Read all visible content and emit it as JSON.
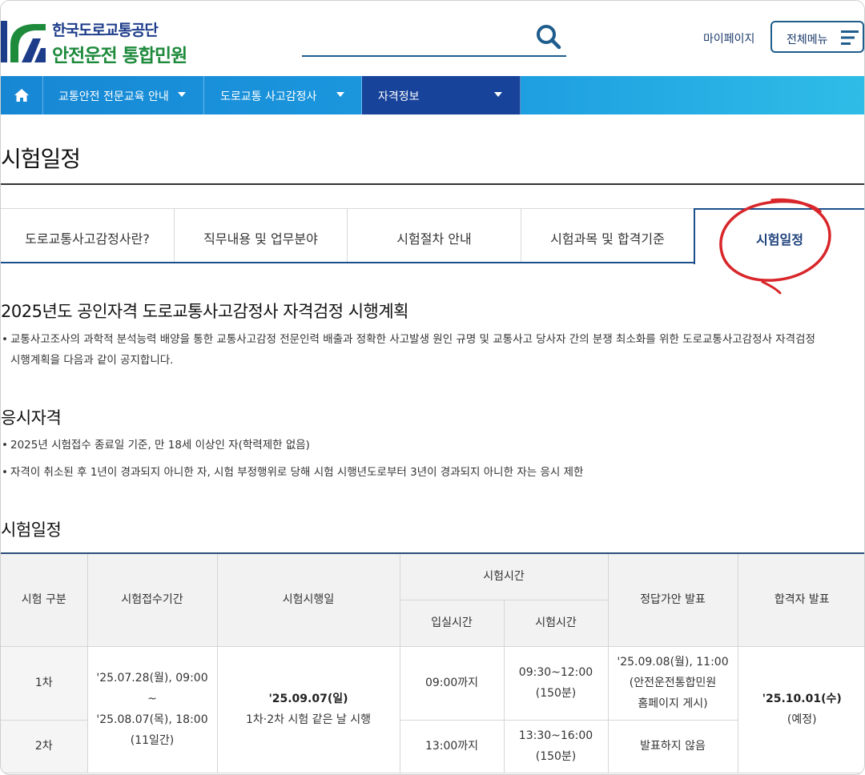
{
  "header": {
    "logo_line1": "한국도로교통공단",
    "logo_line2": "안전운전 통합민원",
    "search_icon": "search-icon",
    "mypage": "마이페이지",
    "allmenu": "전체메뉴",
    "menu_icon": "hamburger-menu-icon"
  },
  "nav": {
    "home_icon": "home-icon",
    "items": [
      {
        "label": "교통안전 전문교육 안내"
      },
      {
        "label": "도로교통 사고감정사"
      },
      {
        "label": "자격정보"
      }
    ],
    "colors": {
      "bar_start": "#1787d4",
      "bar_end": "#2fbde7",
      "active": "#17439b"
    }
  },
  "page_title": "시험일정",
  "tabs": [
    {
      "label": "도로교통사고감정사란?"
    },
    {
      "label": "직무내용 및 업무분야"
    },
    {
      "label": "시험절차 안내"
    },
    {
      "label": "시험과목 및 합격기준"
    },
    {
      "label": "시험일정",
      "active": true
    }
  ],
  "section1": {
    "title": "2025년도 공인자격 도로교통사고감정사 자격검정 시행계획",
    "line1": "교통사고조사의 과학적 분석능력 배양을 통한 교통사고감정 전문인력 배출과 정확한 사고발생 원인 규명 및 교통사고 당사자 간의 분쟁 최소화를 위한 도로교통사고감정사 자격검정",
    "line2": "시행계획을 다음과 같이 공지합니다."
  },
  "section2": {
    "title": "응시자격",
    "items": [
      "2025년 시험접수 종료일 기준, 만 18세 이상인 자(학력제한 없음)",
      "자격이 취소된 후 1년이 경과되지 아니한 자, 시험 부정행위로 당해 시험 시행년도로부터 3년이 경과되지 아니한 자는 응시 제한"
    ]
  },
  "section3": {
    "title": "시험일정",
    "table": {
      "headers": {
        "type": "시험 구분",
        "apply": "시험접수기간",
        "date": "시험시행일",
        "time": "시험시간",
        "entry": "입실시간",
        "exam_time": "시험시간",
        "answer": "정답가안 발표",
        "result": "합격자 발표"
      },
      "rows": [
        {
          "type": "1차",
          "entry": "09:00까지",
          "time": "09:30~12:00",
          "duration": "(150분)",
          "answer1": "'25.09.08(월), 11:00",
          "answer2": "(안전운전통합민원",
          "answer3": "홈페이지 게시)"
        },
        {
          "type": "2차",
          "entry": "13:00까지",
          "time": "13:30~16:00",
          "duration": "(150분)",
          "answer": "발표하지 않음"
        }
      ],
      "apply_start": "'25.07.28(월), 09:00",
      "apply_sep": "~",
      "apply_end": "'25.08.07(목), 18:00",
      "apply_days": "(11일간)",
      "exam_date": "'25.09.07(일)",
      "exam_note": "1차·2차 시험 같은 날 시행",
      "result_date": "'25.10.01(수)",
      "result_note": "(예정)"
    }
  }
}
